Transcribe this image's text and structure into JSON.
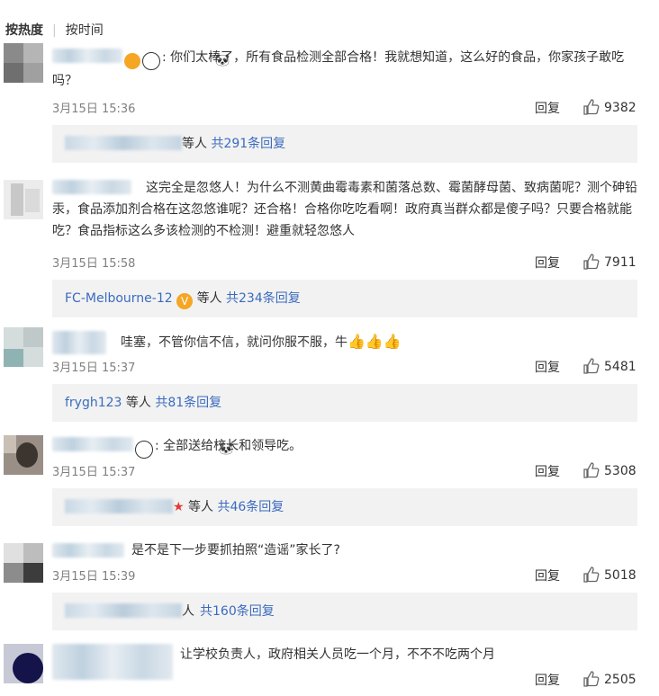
{
  "sort": {
    "hot": "按热度",
    "time": "按时间"
  },
  "reply_label": "回复",
  "etc_label": "等人",
  "comments": [
    {
      "text": "你们太棒了，所有食品检测全部合格！我就想知道，这么好的食品，你家孩子敢吃吗？",
      "date": "3月15日 15:36",
      "likes": "9382",
      "sub_name": "",
      "sub_count": "共291条回复"
    },
    {
      "text": "这完全是忽悠人！为什么不测黄曲霉毒素和菌落总数、霉菌酵母菌、致病菌呢？测个砷铅汞，食品添加剂合格在这忽悠谁呢？还合格！合格你吃吃看啊！政府真当群众都是傻子吗？只要合格就能吃？食品指标这么多该检测的不检测！避重就轻忽悠人",
      "date": "3月15日 15:58",
      "likes": "7911",
      "sub_name": "FC-Melbourne-12",
      "sub_count": "共234条回复"
    },
    {
      "text": "哇塞，不管你信不信，就问你服不服，牛",
      "date": "3月15日 15:37",
      "likes": "5481",
      "sub_name": "frygh123",
      "sub_count": "共81条回复"
    },
    {
      "text": "全部送给校长和领导吃。",
      "date": "3月15日 15:37",
      "likes": "5308",
      "sub_name": "",
      "sub_count": "共46条回复"
    },
    {
      "text": "是不是下一步要抓拍照“造谣”家长了?",
      "date": "3月15日 15:39",
      "likes": "5018",
      "sub_name": "",
      "sub_count": "共160条回复"
    },
    {
      "text": "让学校负责人，政府相关人员吃一个月，不不不吃两个月",
      "date": "",
      "likes": "2505"
    }
  ],
  "colors": {
    "link": "#3b6bbf",
    "meta": "#808080",
    "subbox_bg": "#f2f2f2"
  }
}
